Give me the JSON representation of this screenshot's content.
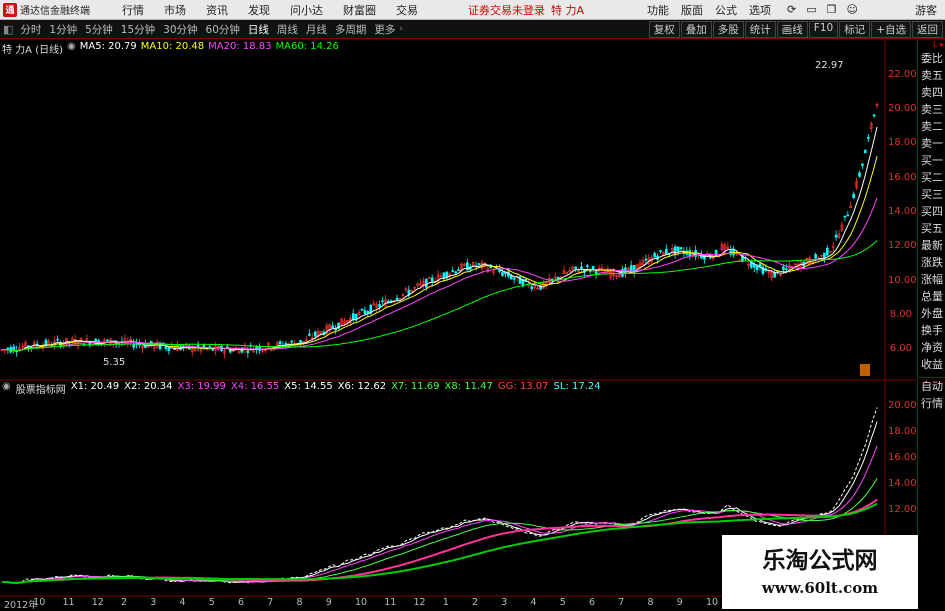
{
  "menubar": {
    "app_title": "通达信金融终端",
    "items": [
      "行情",
      "市场",
      "资讯",
      "发现",
      "问小达",
      "财富圈",
      "交易"
    ],
    "login_status": "证券交易未登录",
    "stock_title": "特 力A",
    "right_items": [
      "功能",
      "版面",
      "公式",
      "选项"
    ],
    "guest": "游客"
  },
  "periods": {
    "items": [
      "分时",
      "1分钟",
      "5分钟",
      "15分钟",
      "30分钟",
      "60分钟",
      "日线",
      "周线",
      "月线",
      "多周期",
      "更多"
    ],
    "active": "日线"
  },
  "tools": [
    "复权",
    "叠加",
    "多股",
    "统计",
    "画线",
    "F10",
    "标记",
    "+自选",
    "返回"
  ],
  "main_legend": {
    "name": "特 力A (日线)",
    "ma": [
      {
        "label": "MA5: 20.79",
        "color": "#ffffff"
      },
      {
        "label": "MA10: 20.48",
        "color": "#ffff00"
      },
      {
        "label": "MA20: 18.83",
        "color": "#ff44ff"
      },
      {
        "label": "MA60: 14.26",
        "color": "#00ff00"
      }
    ],
    "high_label": "22.97",
    "low_label": "5.35"
  },
  "sub_legend": {
    "name": "股票指标网",
    "items": [
      {
        "label": "X1: 20.49",
        "color": "#ffffff"
      },
      {
        "label": "X2: 20.34",
        "color": "#ffffff"
      },
      {
        "label": "X3: 19.99",
        "color": "#ff44ff"
      },
      {
        "label": "X4: 16.55",
        "color": "#ff44ff"
      },
      {
        "label": "X5: 14.55",
        "color": "#ffffff"
      },
      {
        "label": "X6: 12.62",
        "color": "#ffffff"
      },
      {
        "label": "X7: 11.69",
        "color": "#44ff44"
      },
      {
        "label": "X8: 11.47",
        "color": "#44ff44"
      },
      {
        "label": "GG: 13.07",
        "color": "#ff4444"
      },
      {
        "label": "SL: 17.24",
        "color": "#44ffff"
      }
    ]
  },
  "y_axis_main": [
    "22.00",
    "20.00",
    "18.00",
    "16.00",
    "14.00",
    "12.00",
    "10.00",
    "8.00",
    "6.00"
  ],
  "y_axis_sub": [
    "20.00",
    "18.00",
    "16.00",
    "14.00",
    "12.00"
  ],
  "side_panel": [
    "委比",
    "卖五",
    "卖四",
    "卖三",
    "卖二",
    "卖一",
    "买一",
    "买二",
    "买三",
    "买四",
    "买五",
    "最新",
    "涨跌",
    "涨幅",
    "总量",
    "外盘",
    "换手",
    "净资",
    "收益"
  ],
  "side_bottom": [
    "自动",
    "行情"
  ],
  "x_axis": [
    "2012年",
    "10",
    "11",
    "12",
    "2",
    "3",
    "4",
    "5",
    "6",
    "7",
    "8",
    "9",
    "10",
    "11",
    "12",
    "1",
    "2",
    "3",
    "4",
    "5",
    "6",
    "7",
    "8",
    "9",
    "10"
  ],
  "watermark": {
    "title": "乐淘公式网",
    "url": "www.60lt.com"
  },
  "colors": {
    "up": "#ff3333",
    "down": "#00ffff",
    "ma5": "#ffffff",
    "ma10": "#ffff00",
    "ma20": "#ff44ff",
    "ma60": "#00ff00",
    "brand": "#d01010"
  }
}
